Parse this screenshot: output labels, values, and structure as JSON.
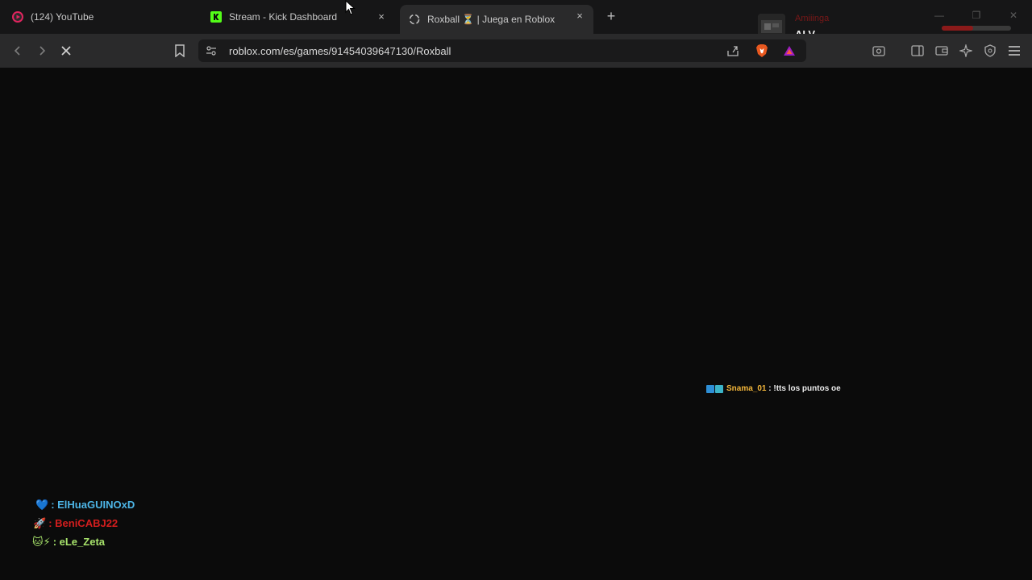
{
  "tabs": [
    {
      "title": "(124) YouTube",
      "favicon": "youtube-icon"
    },
    {
      "title": "Stream - Kick Dashboard",
      "favicon": "kick-icon",
      "close": "×"
    },
    {
      "title": "Roxball ⏳ | Juega en Roblox",
      "favicon": "roblox-icon",
      "close": "×",
      "active": true
    }
  ],
  "new_tab_label": "+",
  "notification": {
    "line1": "Amiiinga",
    "line2": "ALV"
  },
  "window_controls": {
    "minimize": "—",
    "maximize": "❐",
    "close": "✕"
  },
  "progress": 0.45,
  "toolbar": {
    "back": "back-icon",
    "forward": "forward-icon",
    "stop": "stop-icon",
    "bookmark": "bookmark-icon"
  },
  "address_bar": {
    "url": "roblox.com/es/games/91454039647130/Roxball"
  },
  "chat_message": {
    "username": "Snama_01",
    "separator": " : ",
    "text": "!tts los puntos oe"
  },
  "supporters": [
    {
      "emoji": "💙",
      "name": "ElHuaGUINOxD"
    },
    {
      "emoji": "🚀",
      "name": "BeniCABJ22"
    },
    {
      "emoji": "🐱⚡",
      "name": "eLe_Zeta"
    }
  ],
  "supporter_separator": ": ",
  "colors": {
    "tabstrip": "#161617",
    "toolbar": "#2a2a2b",
    "content": "#0b0b0b",
    "supporter1": "#4db6e8",
    "supporter2": "#d41e1e",
    "supporter3": "#a7e36b",
    "chat_username": "#f2b53a"
  }
}
